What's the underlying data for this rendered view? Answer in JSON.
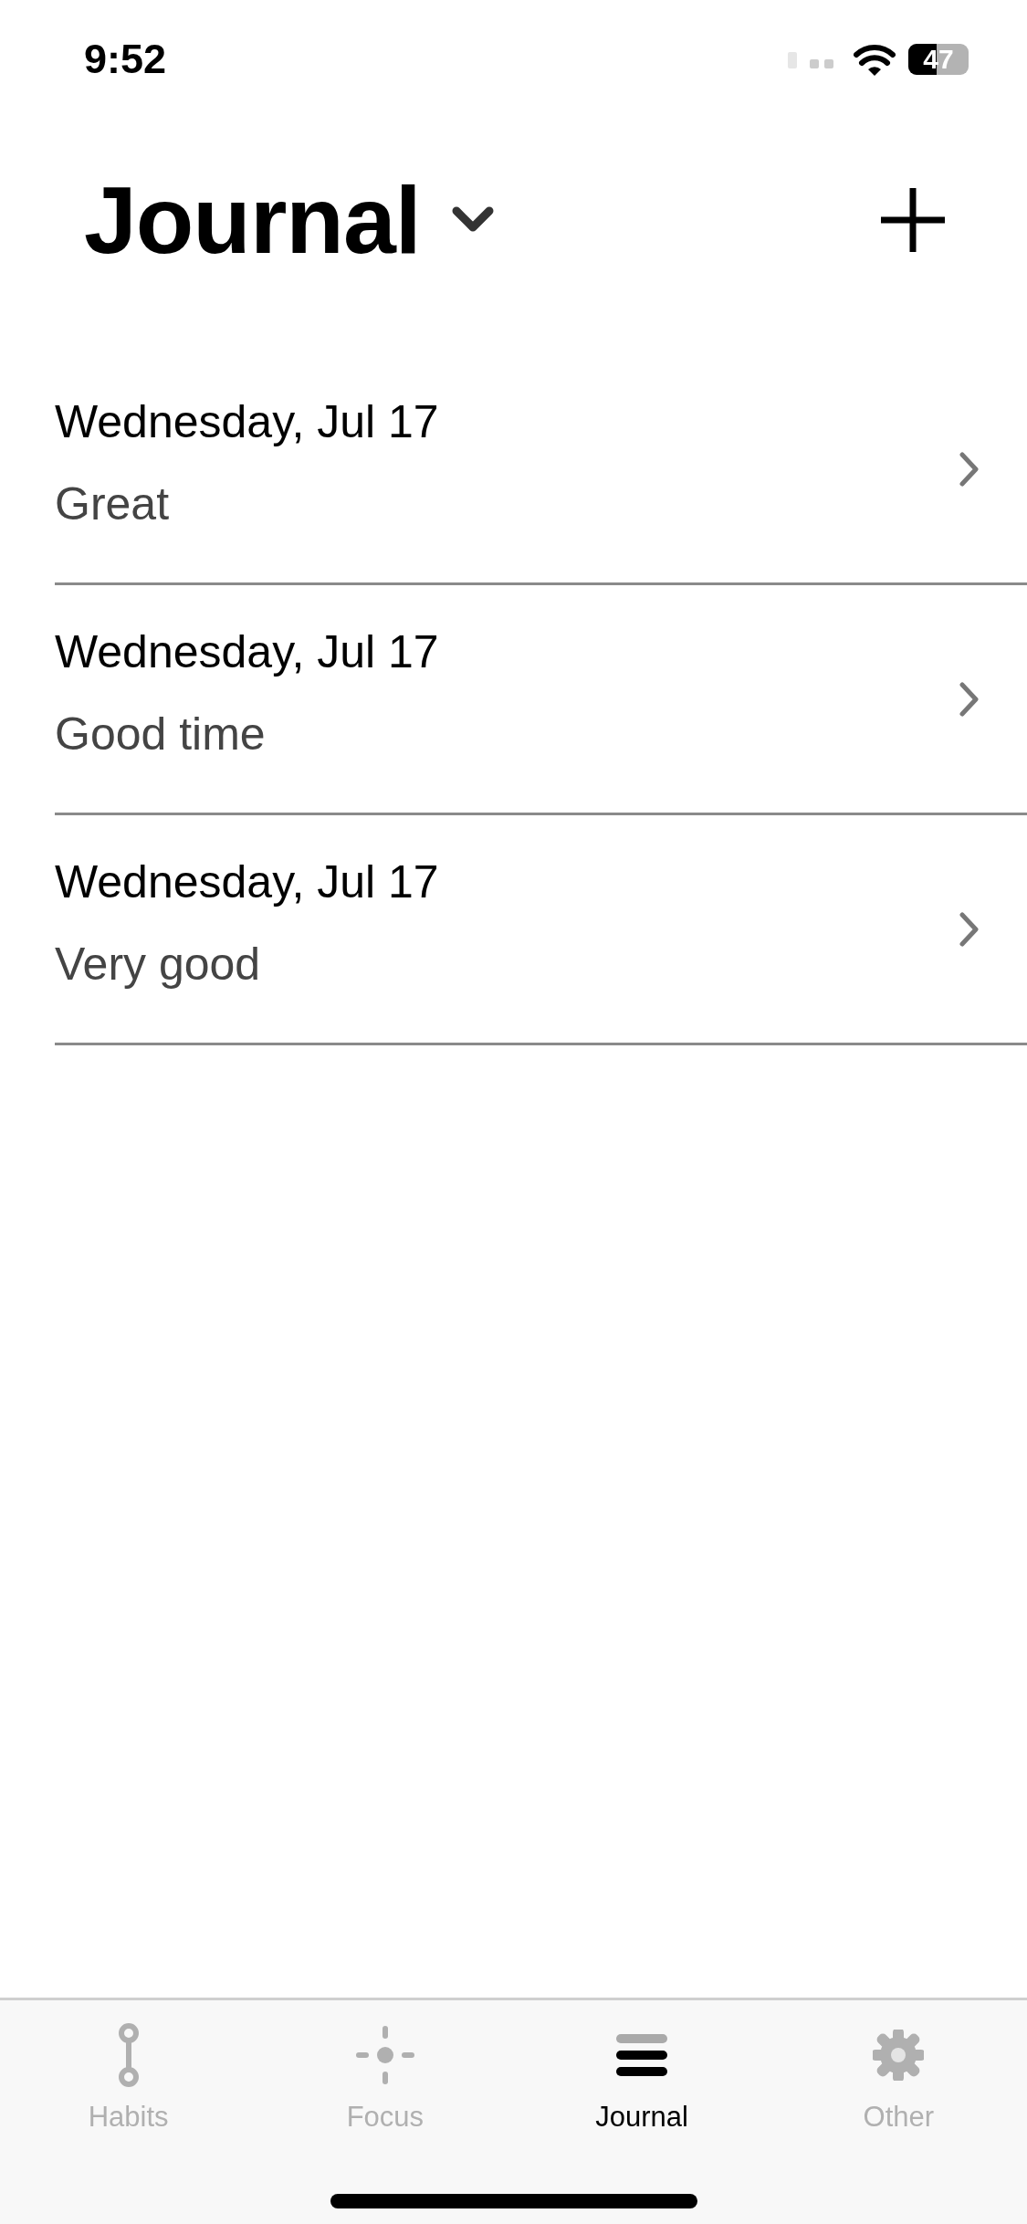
{
  "status_bar": {
    "time": "9:52",
    "battery": "47"
  },
  "header": {
    "title": "Journal"
  },
  "entries": [
    {
      "date": "Wednesday, Jul 17",
      "mood": "Great"
    },
    {
      "date": "Wednesday, Jul 17",
      "mood": "Good time"
    },
    {
      "date": "Wednesday, Jul 17",
      "mood": "Very good"
    }
  ],
  "tab_bar": [
    {
      "kind": "habits",
      "label": "Habits",
      "selected": false
    },
    {
      "kind": "focus",
      "label": "Focus",
      "selected": false
    },
    {
      "kind": "journal",
      "label": "Journal",
      "selected": true
    },
    {
      "kind": "other",
      "label": "Other",
      "selected": false
    }
  ]
}
